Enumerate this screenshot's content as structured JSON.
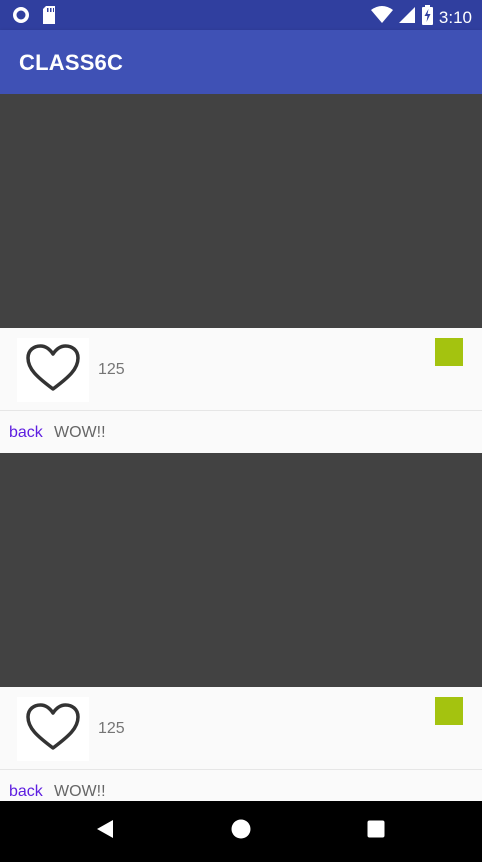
{
  "status_bar": {
    "time": "3:10",
    "left_icons": [
      "circle-notification-icon",
      "sd-card-icon"
    ],
    "right_icons": [
      "wifi-icon",
      "cell-signal-icon",
      "battery-charging-icon"
    ]
  },
  "app_bar": {
    "title": "CLASS6C"
  },
  "posts": [
    {
      "like_count": "125",
      "back_label": "back",
      "caption": "WOW!!",
      "badge_color": "#a4c30f"
    },
    {
      "like_count": "125",
      "back_label": "back",
      "caption": "WOW!!",
      "badge_color": "#a4c30f"
    }
  ],
  "nav_bar": {
    "icons": [
      "back-icon",
      "home-icon",
      "recents-icon"
    ]
  },
  "colors": {
    "status_bar": "#303f9f",
    "app_bar": "#3f51b5",
    "media_placeholder": "#424242",
    "link": "#5e1ee0"
  }
}
